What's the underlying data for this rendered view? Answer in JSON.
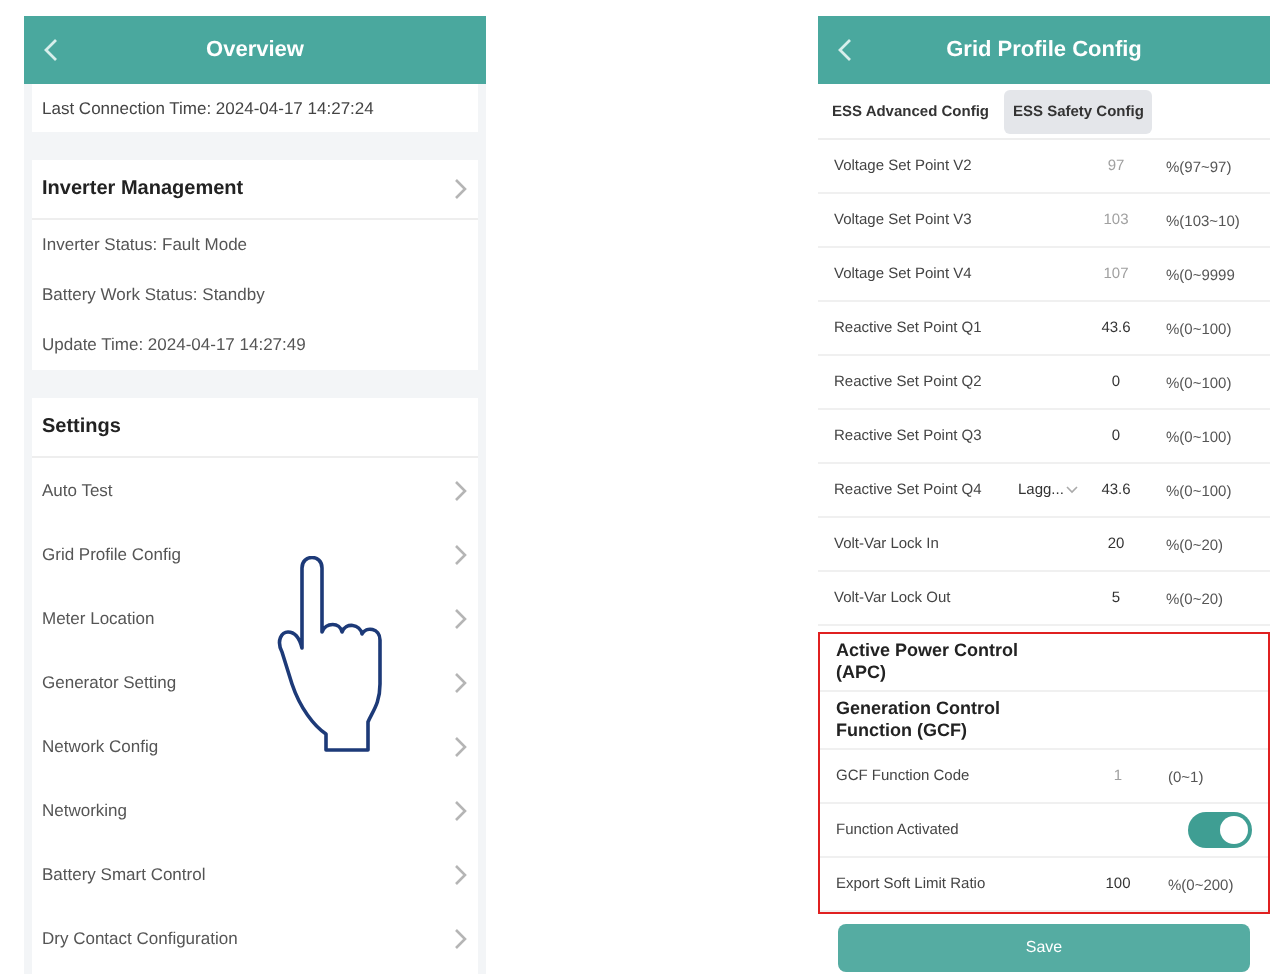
{
  "overview": {
    "title": "Overview",
    "last_connection": "Last Connection Time: 2024-04-17 14:27:24",
    "inverter": {
      "title": "Inverter Management",
      "lines": [
        "Inverter Status: Fault Mode",
        "Battery Work Status: Standby",
        "Update Time: 2024-04-17 14:27:49"
      ]
    },
    "settings": {
      "title": "Settings",
      "items": [
        {
          "label": "Auto Test"
        },
        {
          "label": "Grid Profile Config"
        },
        {
          "label": "Meter Location"
        },
        {
          "label": "Generator Setting"
        },
        {
          "label": "Network Config"
        },
        {
          "label": "Networking"
        },
        {
          "label": "Battery Smart Control"
        },
        {
          "label": "Dry Contact Configuration"
        }
      ]
    }
  },
  "grid_profile": {
    "title": "Grid Profile Config",
    "tabs": [
      {
        "label": "ESS Advanced Config",
        "selected": false
      },
      {
        "label": "ESS Safety Config",
        "selected": true
      }
    ],
    "rows": [
      {
        "kind": "input",
        "label": "Voltage Set Point V2",
        "value": "97",
        "unit": "%(97~97)",
        "disabled": true
      },
      {
        "kind": "input",
        "label": "Voltage Set Point V3",
        "value": "103",
        "unit": "%(103~10)",
        "disabled": true
      },
      {
        "kind": "input",
        "label": "Voltage Set Point V4",
        "value": "107",
        "unit": "%(0~9999",
        "disabled": true
      },
      {
        "kind": "input",
        "label": "Reactive Set Point Q1",
        "value": "43.6",
        "unit": "%(0~100)",
        "disabled": false
      },
      {
        "kind": "input",
        "label": "Reactive Set Point Q2",
        "value": "0",
        "unit": "%(0~100)",
        "disabled": false
      },
      {
        "kind": "input",
        "label": "Reactive Set Point Q3",
        "value": "0",
        "unit": "%(0~100)",
        "disabled": false
      },
      {
        "kind": "select_input",
        "label": "Reactive Set Point Q4",
        "option": "Lagg...",
        "value": "43.6",
        "unit": "%(0~100)",
        "disabled": false
      },
      {
        "kind": "input",
        "label": "Volt-Var Lock In",
        "value": "20",
        "unit": "%(0~20)",
        "disabled": false
      },
      {
        "kind": "input",
        "label": "Volt-Var Lock Out",
        "value": "5",
        "unit": "%(0~20)",
        "disabled": false
      }
    ],
    "highlighted_rows": [
      {
        "kind": "heading",
        "label": "Active Power Control (APC)"
      },
      {
        "kind": "heading",
        "label": "Generation Control Function (GCF)"
      },
      {
        "kind": "input",
        "label": "GCF Function Code",
        "value": "1",
        "unit": "(0~1)",
        "disabled": true
      },
      {
        "kind": "toggle",
        "label": "Function Activated",
        "on": true
      },
      {
        "kind": "input",
        "label": "Export Soft Limit Ratio",
        "value": "100",
        "unit": "%(0~200)",
        "disabled": false
      }
    ],
    "save": "Save"
  }
}
